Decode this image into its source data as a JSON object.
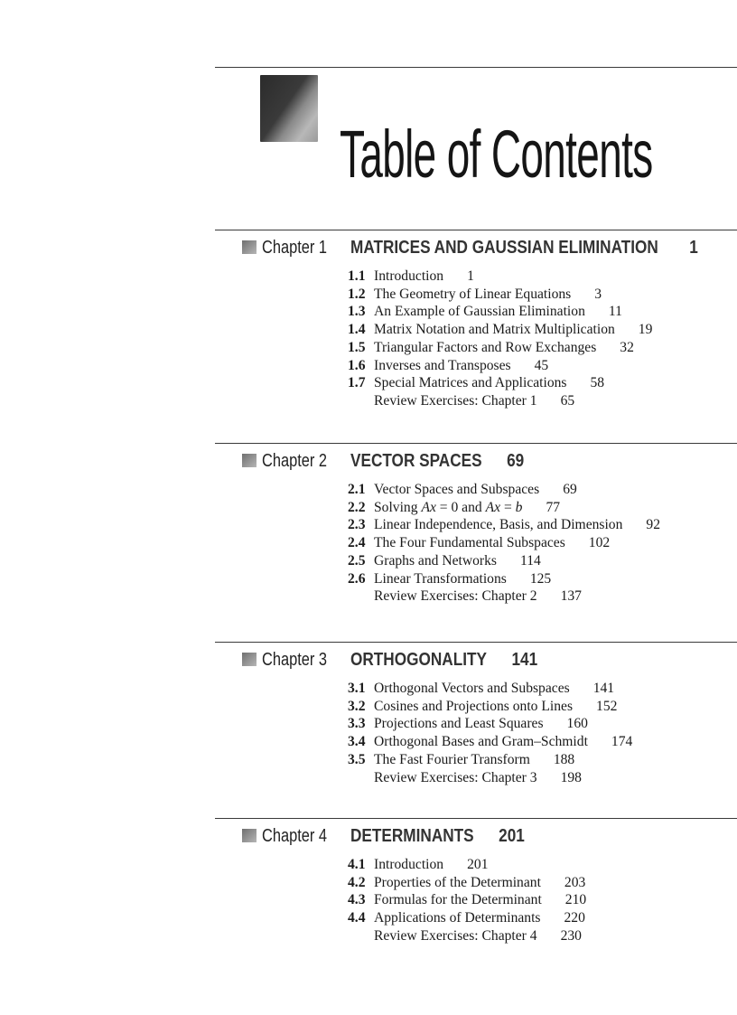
{
  "header": {
    "title": "Table of Contents"
  },
  "chapters": [
    {
      "label": "Chapter 1",
      "title": "MATRICES AND GAUSSIAN ELIMINATION",
      "page": "1",
      "sections": [
        {
          "num": "1.1",
          "title": "Introduction",
          "page": "1"
        },
        {
          "num": "1.2",
          "title": "The Geometry of Linear Equations",
          "page": "3"
        },
        {
          "num": "1.3",
          "title": "An Example of Gaussian Elimination",
          "page": "11"
        },
        {
          "num": "1.4",
          "title": "Matrix Notation and Matrix Multiplication",
          "page": "19"
        },
        {
          "num": "1.5",
          "title": "Triangular Factors and Row Exchanges",
          "page": "32"
        },
        {
          "num": "1.6",
          "title": "Inverses and Transposes",
          "page": "45"
        },
        {
          "num": "1.7",
          "title": "Special Matrices and Applications",
          "page": "58"
        },
        {
          "num": "",
          "title": "Review Exercises: Chapter 1",
          "page": "65"
        }
      ]
    },
    {
      "label": "Chapter 2",
      "title": "VECTOR SPACES",
      "page": "69",
      "sections": [
        {
          "num": "2.1",
          "title": "Vector Spaces and Subspaces",
          "page": "69"
        },
        {
          "num": "2.2",
          "title": "Solving Ax = 0 and Ax = b",
          "page": "77"
        },
        {
          "num": "2.3",
          "title": "Linear Independence, Basis, and Dimension",
          "page": "92"
        },
        {
          "num": "2.4",
          "title": "The Four Fundamental Subspaces",
          "page": "102"
        },
        {
          "num": "2.5",
          "title": "Graphs and Networks",
          "page": "114"
        },
        {
          "num": "2.6",
          "title": "Linear Transformations",
          "page": "125"
        },
        {
          "num": "",
          "title": "Review Exercises: Chapter 2",
          "page": "137"
        }
      ]
    },
    {
      "label": "Chapter 3",
      "title": "ORTHOGONALITY",
      "page": "141",
      "sections": [
        {
          "num": "3.1",
          "title": "Orthogonal Vectors and Subspaces",
          "page": "141"
        },
        {
          "num": "3.2",
          "title": "Cosines and Projections onto Lines",
          "page": "152"
        },
        {
          "num": "3.3",
          "title": "Projections and Least Squares",
          "page": "160"
        },
        {
          "num": "3.4",
          "title": "Orthogonal Bases and Gram–Schmidt",
          "page": "174"
        },
        {
          "num": "3.5",
          "title": "The Fast Fourier Transform",
          "page": "188"
        },
        {
          "num": "",
          "title": "Review Exercises: Chapter 3",
          "page": "198"
        }
      ]
    },
    {
      "label": "Chapter 4",
      "title": "DETERMINANTS",
      "page": "201",
      "sections": [
        {
          "num": "4.1",
          "title": "Introduction",
          "page": "201"
        },
        {
          "num": "4.2",
          "title": "Properties of the Determinant",
          "page": "203"
        },
        {
          "num": "4.3",
          "title": "Formulas for the Determinant",
          "page": "210"
        },
        {
          "num": "4.4",
          "title": "Applications of Determinants",
          "page": "220"
        },
        {
          "num": "",
          "title": "Review Exercises: Chapter 4",
          "page": "230"
        }
      ]
    }
  ]
}
